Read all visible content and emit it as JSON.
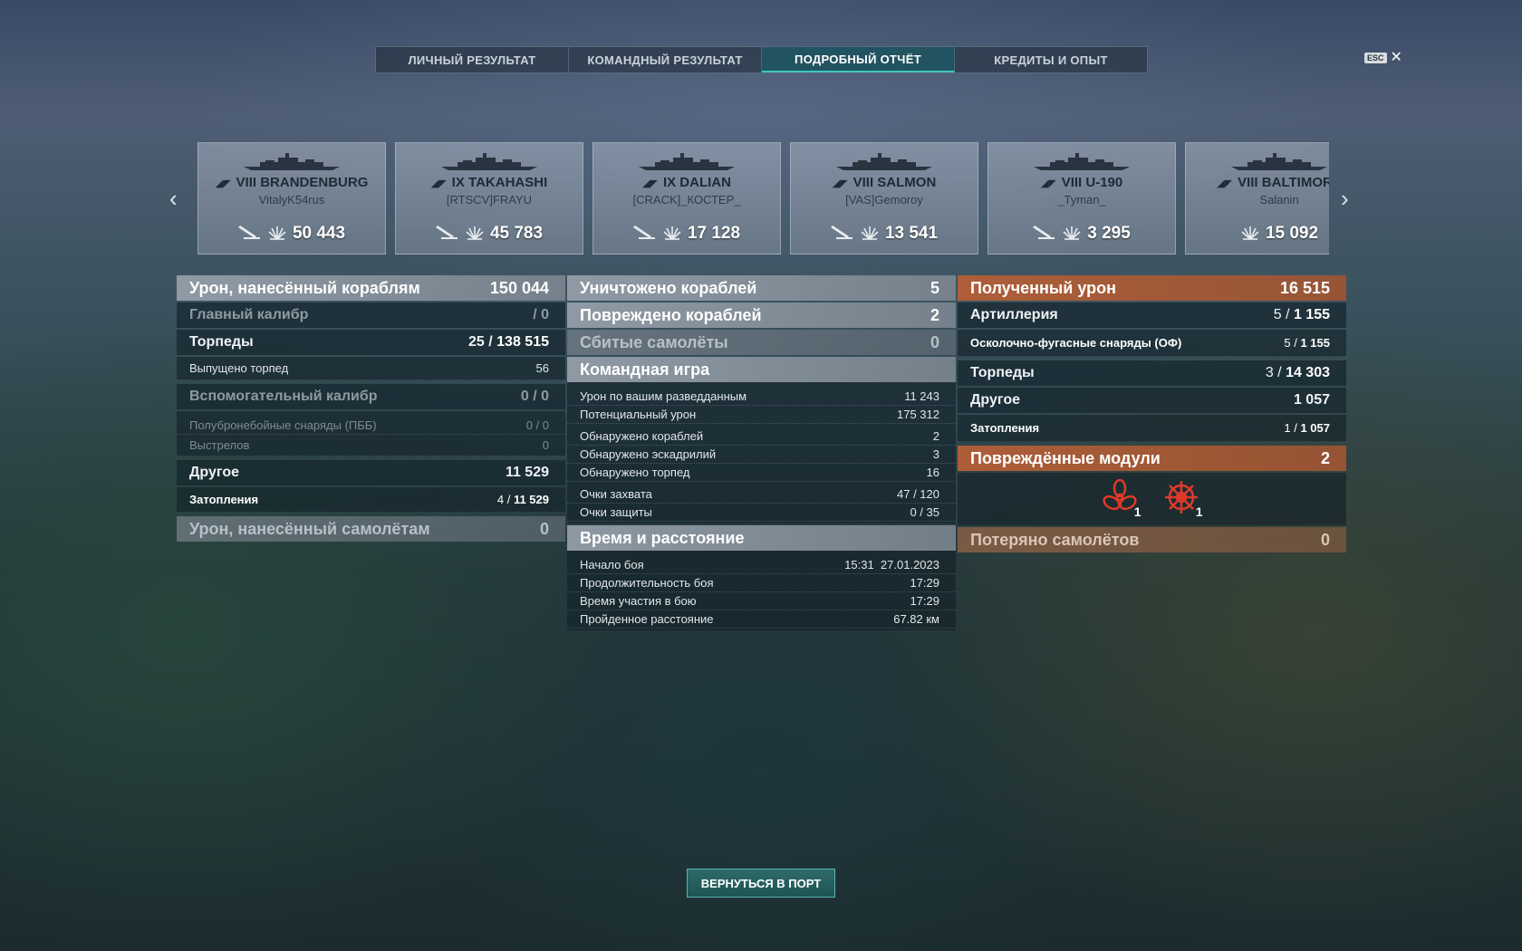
{
  "tabs": [
    {
      "label": "ЛИЧНЫЙ РЕЗУЛЬТАТ"
    },
    {
      "label": "КОМАНДНЫЙ РЕЗУЛЬТАТ"
    },
    {
      "label": "ПОДРОБНЫЙ ОТЧЁТ"
    },
    {
      "label": "КРЕДИТЫ И ОПЫТ"
    }
  ],
  "esc_key": "ESC",
  "ships": [
    {
      "tier": "VIII",
      "name": "BRANDENBURG",
      "player": "VitalyK54rus",
      "damage": "50 443"
    },
    {
      "tier": "IX",
      "name": "TAKAHASHI",
      "player": "[RTSCV]FRAYU",
      "damage": "45 783"
    },
    {
      "tier": "IX",
      "name": "DALIAN",
      "player": "[CRACK]_КОСТЕР_",
      "damage": "17 128"
    },
    {
      "tier": "VIII",
      "name": "SALMON",
      "player": "[VAS]Gemoroy",
      "damage": "13 541"
    },
    {
      "tier": "VIII",
      "name": "U-190",
      "player": "_Tyman_",
      "damage": "3 295"
    },
    {
      "tier": "VIII",
      "name": "BALTIMORE",
      "player": "Salanin",
      "damage": "15 092"
    }
  ],
  "col1": {
    "damage_ships": {
      "label": "Урон, нанесённый кораблям",
      "value": "150 044"
    },
    "main_caliber": {
      "label": "Главный калибр",
      "value": "/ 0"
    },
    "torpedoes": {
      "label": "Торпеды",
      "count": "25 /",
      "value": "138 515"
    },
    "torpedoes_fired": {
      "label": "Выпущено торпед",
      "value": "56"
    },
    "secondary": {
      "label": "Вспомогательный калибр",
      "value": "0 / 0"
    },
    "ap_shells": {
      "label": "Полубронебойные снаряды (ПББ)",
      "value": "0 / 0"
    },
    "shots": {
      "label": "Выстрелов",
      "value": "0"
    },
    "other": {
      "label": "Другое",
      "value": "11 529"
    },
    "flooding": {
      "label": "Затопления",
      "count": "4 /",
      "value": "11 529"
    },
    "damage_planes": {
      "label": "Урон, нанесённый самолётам",
      "value": "0"
    }
  },
  "col2": {
    "destroyed": {
      "label": "Уничтожено кораблей",
      "value": "5"
    },
    "damaged": {
      "label": "Повреждено кораблей",
      "value": "2"
    },
    "planes_shot": {
      "label": "Сбитые самолёты",
      "value": "0"
    },
    "team_play": {
      "label": "Командная игра"
    },
    "spotting_damage": {
      "label": "Урон по вашим разведданным",
      "value": "11 243"
    },
    "potential_damage": {
      "label": "Потенциальный урон",
      "value": "175 312"
    },
    "spotted_ships": {
      "label": "Обнаружено кораблей",
      "value": "2"
    },
    "spotted_squadrons": {
      "label": "Обнаружено эскадрилий",
      "value": "3"
    },
    "spotted_torpedoes": {
      "label": "Обнаружено торпед",
      "value": "16"
    },
    "capture_points": {
      "label": "Очки захвата",
      "value": "47 / 120"
    },
    "defense_points": {
      "label": "Очки защиты",
      "value": "0 / 35"
    },
    "time_distance": {
      "label": "Время и расстояние"
    },
    "battle_start": {
      "label": "Начало боя",
      "value": "15:31  27.01.2023"
    },
    "battle_duration": {
      "label": "Продолжительность боя",
      "value": "17:29"
    },
    "participation_time": {
      "label": "Время участия в бою",
      "value": "17:29"
    },
    "distance": {
      "label": "Пройденное расстояние",
      "value": "67.82 км"
    }
  },
  "col3": {
    "received": {
      "label": "Полученный урон",
      "value": "16 515"
    },
    "artillery": {
      "label": "Артиллерия",
      "count": "5 /",
      "value": "1 155"
    },
    "he_shells": {
      "label": "Осколочно-фугасные снаряды (ОФ)",
      "count": "5 /",
      "value": "1 155"
    },
    "torpedoes": {
      "label": "Торпеды",
      "count": "3 /",
      "value": "14 303"
    },
    "other": {
      "label": "Другое",
      "value": "1 057"
    },
    "flooding": {
      "label": "Затопления",
      "count": "1 /",
      "value": "1 057"
    },
    "modules": {
      "label": "Повреждённые модули",
      "value": "2"
    },
    "module_propeller": {
      "icon": "propeller-icon",
      "count": "1"
    },
    "module_steering": {
      "icon": "steering-gear-icon",
      "count": "1"
    },
    "planes_lost": {
      "label": "Потеряно самолётов",
      "value": "0"
    }
  },
  "return_button": "ВЕРНУТЬСЯ В ПОРТ",
  "colors": {
    "accent": "#3fc7c0",
    "orange": "#b45f37"
  }
}
